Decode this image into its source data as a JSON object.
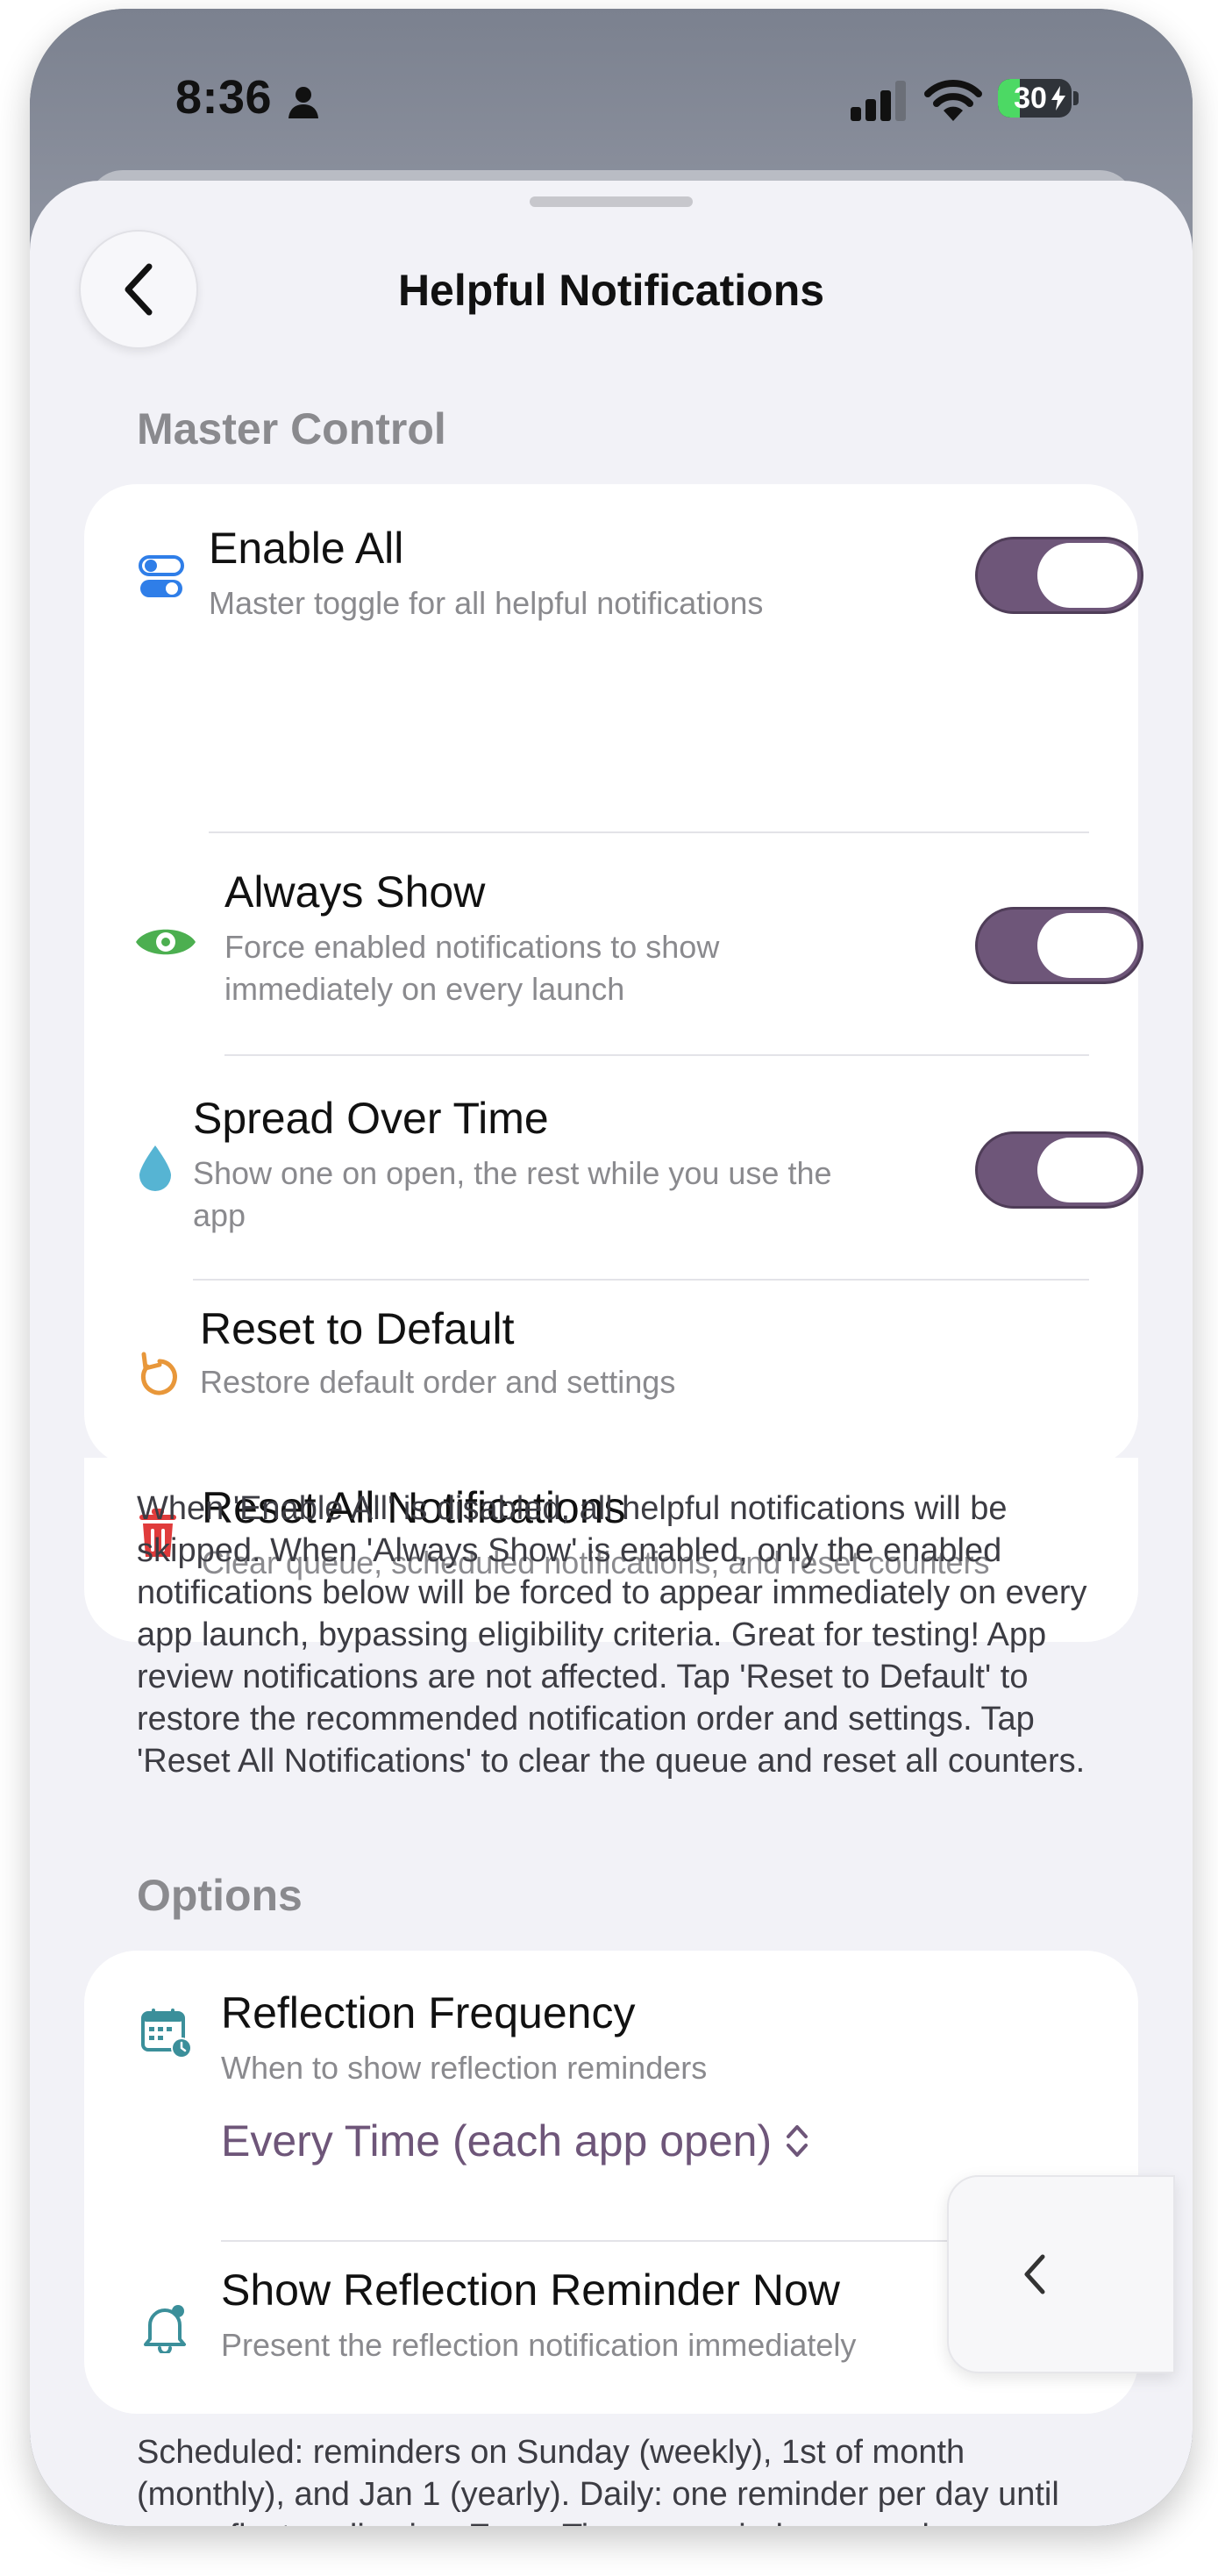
{
  "status_bar": {
    "time": "8:36",
    "battery_percent": "30",
    "battery_level": 0.3
  },
  "nav": {
    "title": "Helpful Notifications"
  },
  "master_control": {
    "header": "Master Control",
    "rows": [
      {
        "icon": "toggles-icon",
        "icon_color": "#2f7ee8",
        "title": "Enable All",
        "subtitle": "Master toggle for all helpful notifications",
        "toggle_on": true
      },
      {
        "icon": "eye-icon",
        "icon_color": "#4caf50",
        "title": "Always Show",
        "subtitle": "Force enabled notifications to show immediately on every launch",
        "toggle_on": true
      },
      {
        "icon": "drop-icon",
        "icon_color": "#56b4d3",
        "title": "Spread Over Time",
        "subtitle": "Show one on open, the rest while you use the app",
        "toggle_on": true
      },
      {
        "icon": "reset-arrow-icon",
        "icon_color": "#e8973a",
        "title": "Reset to Default",
        "subtitle": "Restore default order and settings"
      },
      {
        "icon": "trash-icon",
        "icon_color": "#e03b3b",
        "title": "Reset All Notifications",
        "subtitle": "Clear queue, scheduled notifications, and reset counters"
      }
    ],
    "footnote": "When 'Enable All' is disabled, all helpful notifications will be skipped. When 'Always Show' is enabled, only the enabled notifications below will be forced to appear immediately on every app launch, bypassing eligibility criteria. Great for testing! App review notifications are not affected. Tap 'Reset to Default' to restore the recommended notification order and settings. Tap 'Reset All Notifications' to clear the queue and reset all counters."
  },
  "options": {
    "header": "Options",
    "rows": [
      {
        "icon": "calendar-clock-icon",
        "icon_color": "#3b8f9a",
        "title": "Reflection Frequency",
        "subtitle": "When to show reflection reminders",
        "picker_value": "Every Time (each app open)"
      },
      {
        "icon": "bell-icon",
        "icon_color": "#3b8f9a",
        "title": "Show Reflection Reminder Now",
        "subtitle": "Present the reflection notification immediately"
      }
    ],
    "footnote": "Scheduled: reminders on Sunday (weekly), 1st of month (monthly), and Jan 1 (yearly). Daily: one reminder per day until you reflect or dismiss. Every Time: a reminder on each"
  },
  "colors": {
    "accent": "#6e5679",
    "background": "#f2f2f7",
    "card": "#ffffff",
    "secondary_text": "#8a8a8e"
  }
}
